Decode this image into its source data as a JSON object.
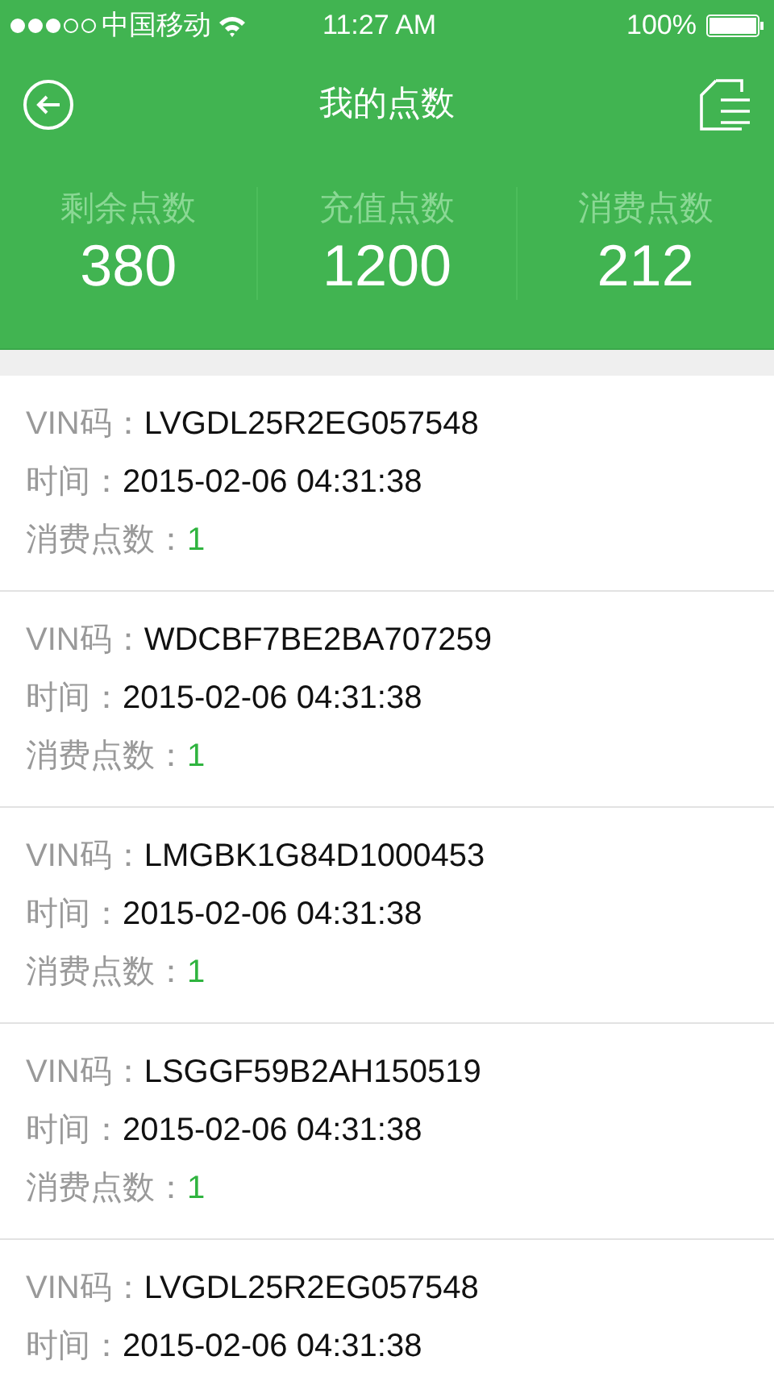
{
  "status_bar": {
    "carrier": "中国移动",
    "time": "11:27 AM",
    "battery": "100%"
  },
  "nav": {
    "title": "我的点数"
  },
  "stats": [
    {
      "label": "剩余点数",
      "value": "380"
    },
    {
      "label": "充值点数",
      "value": "1200"
    },
    {
      "label": "消费点数",
      "value": "212"
    }
  ],
  "records": [
    {
      "fields": [
        {
          "label": "VIN码：",
          "value": "LVGDL25R2EG057548",
          "kind": "plain"
        },
        {
          "label": "时间：",
          "value": "2015-02-06 04:31:38",
          "kind": "plain"
        },
        {
          "label": "消费点数：",
          "value": "1",
          "kind": "points"
        }
      ]
    },
    {
      "fields": [
        {
          "label": "VIN码：",
          "value": "WDCBF7BE2BA707259",
          "kind": "plain"
        },
        {
          "label": "时间：",
          "value": "2015-02-06 04:31:38",
          "kind": "plain"
        },
        {
          "label": "消费点数：",
          "value": "1",
          "kind": "points"
        }
      ]
    },
    {
      "fields": [
        {
          "label": "VIN码：",
          "value": "LMGBK1G84D1000453",
          "kind": "plain"
        },
        {
          "label": "时间：",
          "value": "2015-02-06 04:31:38",
          "kind": "plain"
        },
        {
          "label": "消费点数：",
          "value": "1",
          "kind": "points"
        }
      ]
    },
    {
      "fields": [
        {
          "label": "VIN码：",
          "value": "LSGGF59B2AH150519",
          "kind": "plain"
        },
        {
          "label": "时间：",
          "value": "2015-02-06 04:31:38",
          "kind": "plain"
        },
        {
          "label": "消费点数：",
          "value": "1",
          "kind": "points"
        }
      ]
    },
    {
      "fields": [
        {
          "label": "VIN码：",
          "value": "LVGDL25R2EG057548",
          "kind": "plain"
        },
        {
          "label": "时间：",
          "value": "2015-02-06 04:31:38",
          "kind": "plain"
        }
      ]
    }
  ]
}
